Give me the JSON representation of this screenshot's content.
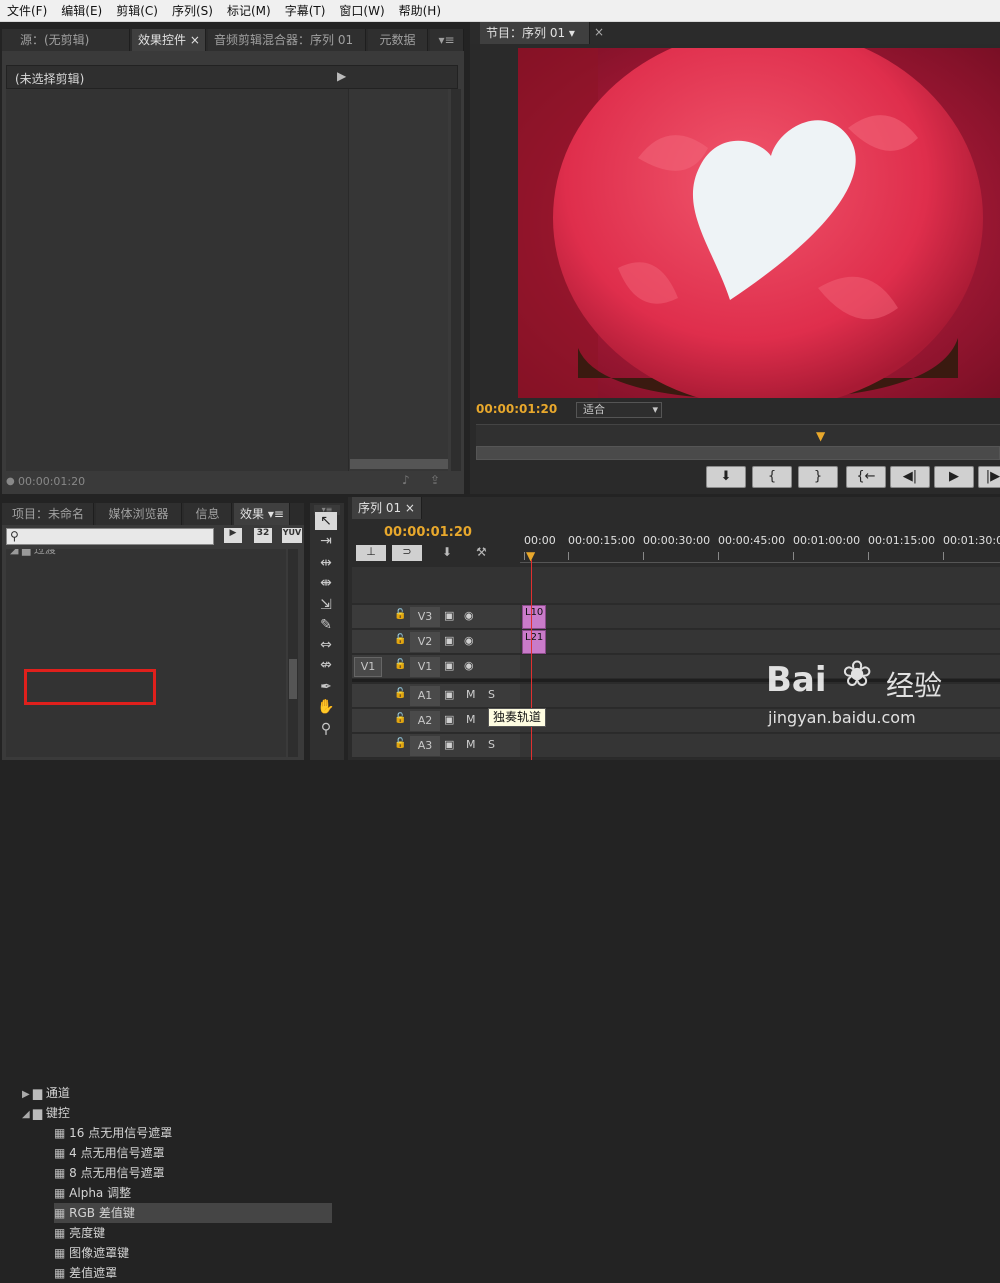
{
  "menu": [
    "文件(F)",
    "编辑(E)",
    "剪辑(C)",
    "序列(S)",
    "标记(M)",
    "字幕(T)",
    "窗口(W)",
    "帮助(H)"
  ],
  "source_panel": {
    "tabs": [
      "源：(无剪辑)",
      "效果控件",
      "音频剪辑混合器：序列 01",
      "元数据"
    ],
    "no_clip": "(未选择剪辑)",
    "timecode": "00:00:01:20"
  },
  "program": {
    "tab": "节目：序列 01",
    "timecode": "00:00:01:20",
    "fit": "适合"
  },
  "project": {
    "tabs": [
      "项目：未命名",
      "媒体浏览器",
      "信息",
      "效果"
    ],
    "badges": [
      "32",
      "YUV"
    ]
  },
  "effects_tree": [
    {
      "label": "通道",
      "type": "folder",
      "state": "collapsed",
      "indent": 0
    },
    {
      "label": "键控",
      "type": "folder",
      "state": "expanded",
      "indent": 0
    },
    {
      "label": "16 点无用信号遮罩",
      "type": "effect",
      "indent": 1
    },
    {
      "label": "4 点无用信号遮罩",
      "type": "effect",
      "indent": 1
    },
    {
      "label": "8 点无用信号遮罩",
      "type": "effect",
      "indent": 1
    },
    {
      "label": "Alpha 调整",
      "type": "effect",
      "indent": 1
    },
    {
      "label": "RGB 差值键",
      "type": "effect",
      "indent": 1,
      "highlighted": true
    },
    {
      "label": "亮度键",
      "type": "effect",
      "indent": 1
    },
    {
      "label": "图像遮罩键",
      "type": "effect",
      "indent": 1
    },
    {
      "label": "差值遮罩",
      "type": "effect",
      "indent": 1
    }
  ],
  "timeline": {
    "tab": "序列 01",
    "timecode": "00:00:01:20",
    "ruler": [
      "00:00",
      "00:00:15:00",
      "00:00:30:00",
      "00:00:45:00",
      "00:01:00:00",
      "00:01:15:00",
      "00:01:30:00"
    ],
    "video_tracks": [
      "V3",
      "V2",
      "V1"
    ],
    "source_patch": "V1",
    "audio_tracks": [
      "A1",
      "A2",
      "A3"
    ],
    "clips": [
      {
        "label": "L10",
        "track": "V3"
      },
      {
        "label": "L21",
        "track": "V2"
      }
    ],
    "tooltip": "独奏轨道",
    "m": "M",
    "s": "S"
  },
  "watermark": {
    "brand": "Bai",
    "brand2": "经验",
    "url": "jingyan.baidu.com"
  },
  "colors": {
    "accent": "#e8a82c",
    "clip": "#c97bc9",
    "playhead": "#e03030",
    "highlight_box": "#e0201c"
  }
}
